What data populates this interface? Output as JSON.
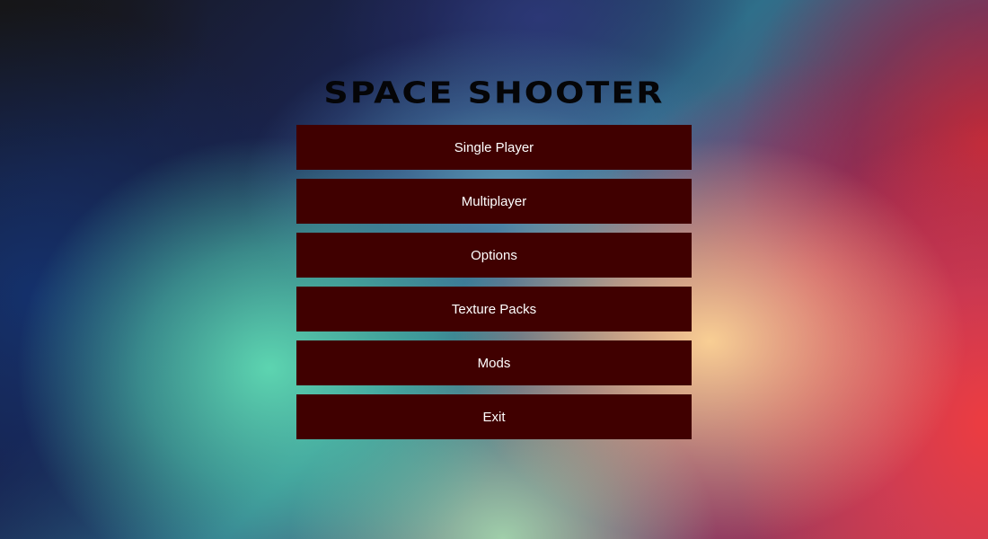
{
  "title": "SPACE SHOOTER",
  "menu": {
    "items": [
      {
        "label": "Single Player"
      },
      {
        "label": "Multiplayer"
      },
      {
        "label": "Options"
      },
      {
        "label": "Texture Packs"
      },
      {
        "label": "Mods"
      },
      {
        "label": "Exit"
      }
    ]
  },
  "colors": {
    "button_bg": "#400000",
    "button_text": "#ffffff",
    "title_text": "#050507"
  }
}
